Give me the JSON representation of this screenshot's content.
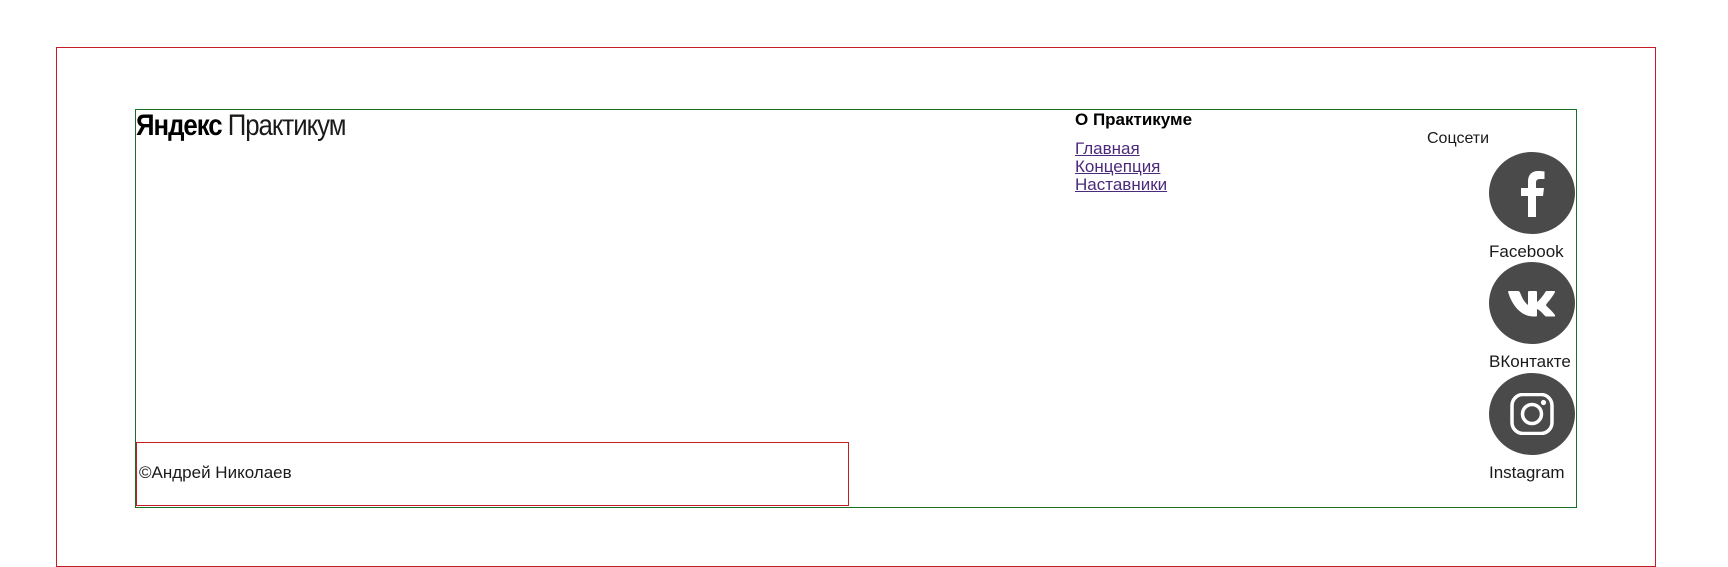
{
  "logo": {
    "brand": "Яндекс",
    "product": "Практикум"
  },
  "about": {
    "title": "О Практикуме",
    "links": [
      "Главная",
      "Концепция",
      "Наставники"
    ]
  },
  "social": {
    "title": "Соцсети",
    "items": [
      {
        "label": "Facebook",
        "icon": "facebook-icon"
      },
      {
        "label": "ВКонтакте",
        "icon": "vk-icon"
      },
      {
        "label": "Instagram",
        "icon": "instagram-icon"
      }
    ]
  },
  "copyright": {
    "text": "©Андрей Николаев"
  },
  "colors": {
    "outer_border": "#c41e25",
    "footer_border": "#1c6f26",
    "link": "#4b2a7b",
    "icon_circle": "#4a4a4a"
  }
}
